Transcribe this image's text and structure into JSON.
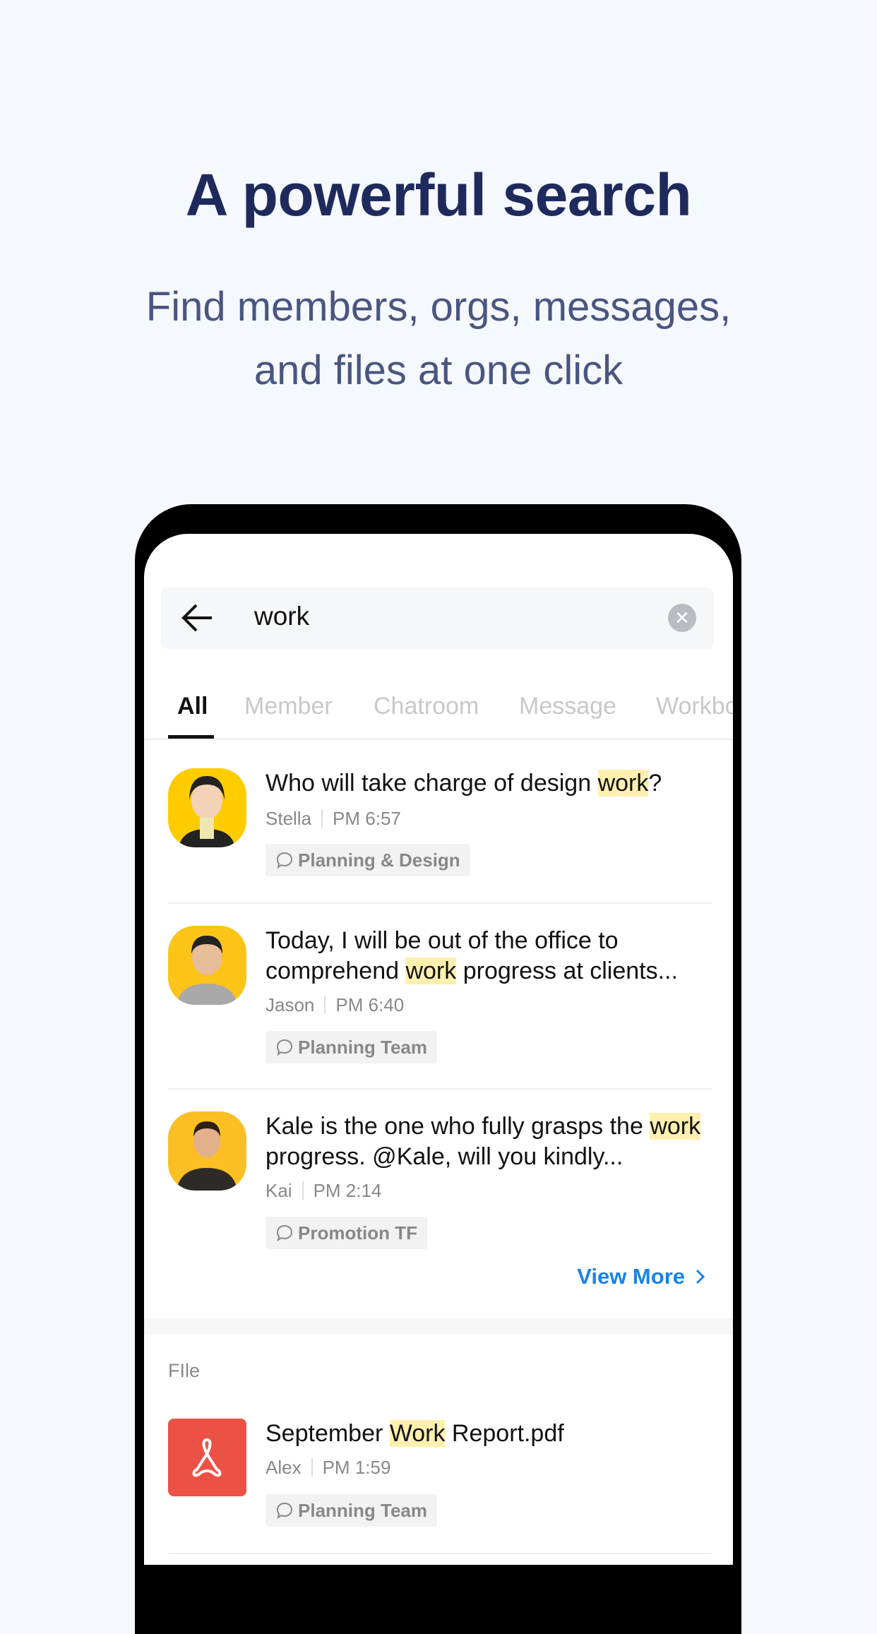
{
  "headline": "A powerful search",
  "subtitle_lines": [
    "Find members, orgs, messages,",
    "and files at one click"
  ],
  "search": {
    "query": "work",
    "back_icon": "arrow-left-icon",
    "clear_icon": "close-circle-icon"
  },
  "tabs": [
    {
      "label": "All",
      "active": true
    },
    {
      "label": "Member"
    },
    {
      "label": "Chatroom"
    },
    {
      "label": "Message"
    },
    {
      "label": "Workbo"
    }
  ],
  "messages": [
    {
      "pre": "Who will take charge of design ",
      "hl": "work",
      "post": "?",
      "author": "Stella",
      "time": "PM 6:57",
      "room": "Planning & Design"
    },
    {
      "pre": "Today, I will be out of the office to comprehend ",
      "hl": "work",
      "post": " progress at clients...",
      "author": "Jason",
      "time": "PM 6:40",
      "room": "Planning Team"
    },
    {
      "pre": "Kale is the one who fully grasps the ",
      "hl": "work",
      "post": " progress. @Kale, will you kindly...",
      "author": "Kai",
      "time": "PM 2:14",
      "room": "Promotion TF"
    }
  ],
  "view_more": "View More",
  "file_section": {
    "label": "FIle",
    "files": [
      {
        "pre": "September ",
        "hl": "Work",
        "post": " Report.pdf",
        "author": "Alex",
        "time": "PM 1:59",
        "room": "Planning Team",
        "icon": "pdf-icon"
      }
    ]
  },
  "colors": {
    "title": "#1f2a5c",
    "accent": "#1a82e6",
    "highlight": "#fff0b0",
    "pdf": "#ec5145",
    "avatar_bg": "#fcc419"
  }
}
